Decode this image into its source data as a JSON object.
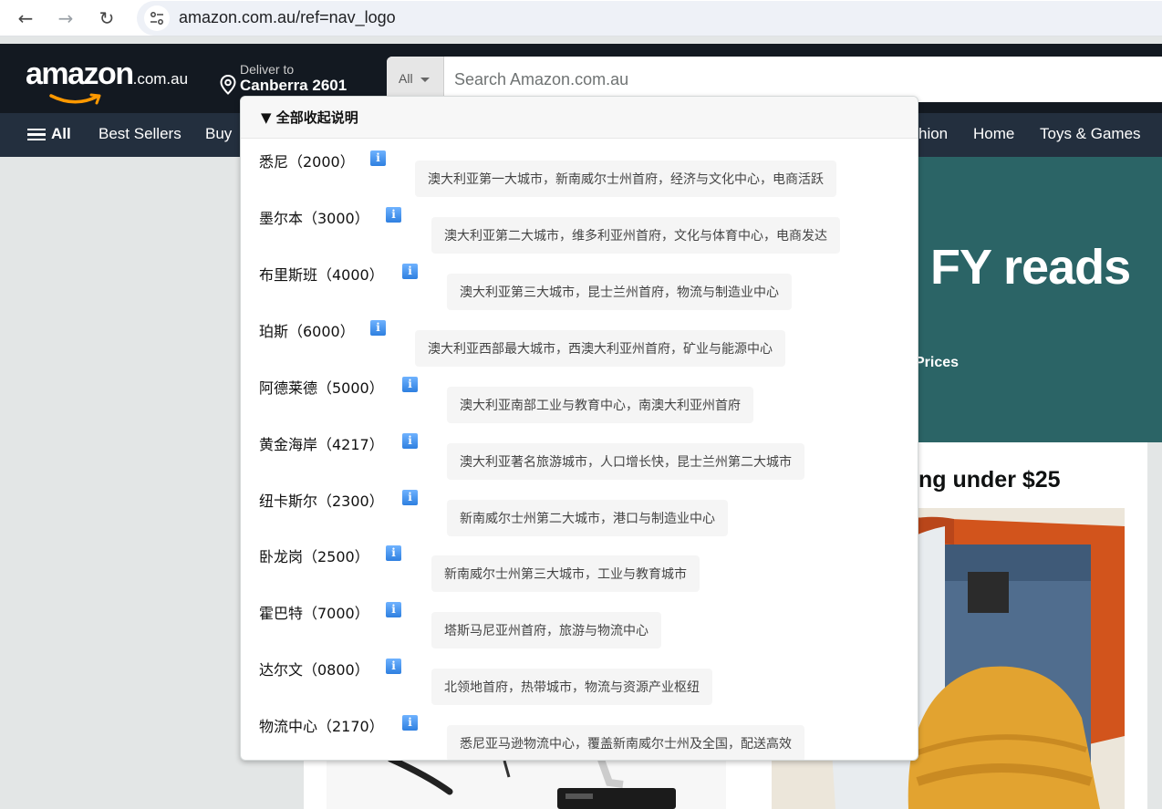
{
  "browser": {
    "back_icon": "arrow-left-icon",
    "forward_icon": "arrow-right-icon",
    "reload_icon": "reload-icon",
    "url": "amazon.com.au/ref=nav_logo"
  },
  "header": {
    "logo_main": "amazon",
    "logo_suffix": ".com.au",
    "deliver_label": "Deliver to",
    "deliver_location": "Canberra 2601",
    "search_category": "All",
    "search_placeholder": "Search Amazon.com.au"
  },
  "subnav": {
    "all_label": "All",
    "items": [
      "Best Sellers",
      "Buy",
      "hion",
      "Home",
      "Toys & Games"
    ]
  },
  "hero": {
    "headline_fragment": "FY reads",
    "prices_fragment": "Prices",
    "card_title_fragment": "ng under $25"
  },
  "dropdown": {
    "header": "▼ 全部收起说明",
    "rows": [
      {
        "city": "悉尼（2000）",
        "desc": "澳大利亚第一大城市，新南威尔士州首府，经济与文化中心，电商活跃"
      },
      {
        "city": "墨尔本（3000）",
        "desc": "澳大利亚第二大城市，维多利亚州首府，文化与体育中心，电商发达"
      },
      {
        "city": "布里斯班（4000）",
        "desc": "澳大利亚第三大城市，昆士兰州首府，物流与制造业中心"
      },
      {
        "city": "珀斯（6000）",
        "desc": "澳大利亚西部最大城市，西澳大利亚州首府，矿业与能源中心"
      },
      {
        "city": "阿德莱德（5000）",
        "desc": "澳大利亚南部工业与教育中心，南澳大利亚州首府"
      },
      {
        "city": "黄金海岸（4217）",
        "desc": "澳大利亚著名旅游城市，人口增长快，昆士兰州第二大城市"
      },
      {
        "city": "纽卡斯尔（2300）",
        "desc": "新南威尔士州第二大城市，港口与制造业中心"
      },
      {
        "city": "卧龙岗（2500）",
        "desc": "新南威尔士州第三大城市，工业与教育城市"
      },
      {
        "city": "霍巴特（7000）",
        "desc": "塔斯马尼亚州首府，旅游与物流中心"
      },
      {
        "city": "达尔文（0800）",
        "desc": "北领地首府，热带城市，物流与资源产业枢纽"
      },
      {
        "city": "物流中心（2170）",
        "desc": "悉尼亚马逊物流中心，覆盖新南威尔士州及全国，配送高效"
      }
    ]
  }
}
